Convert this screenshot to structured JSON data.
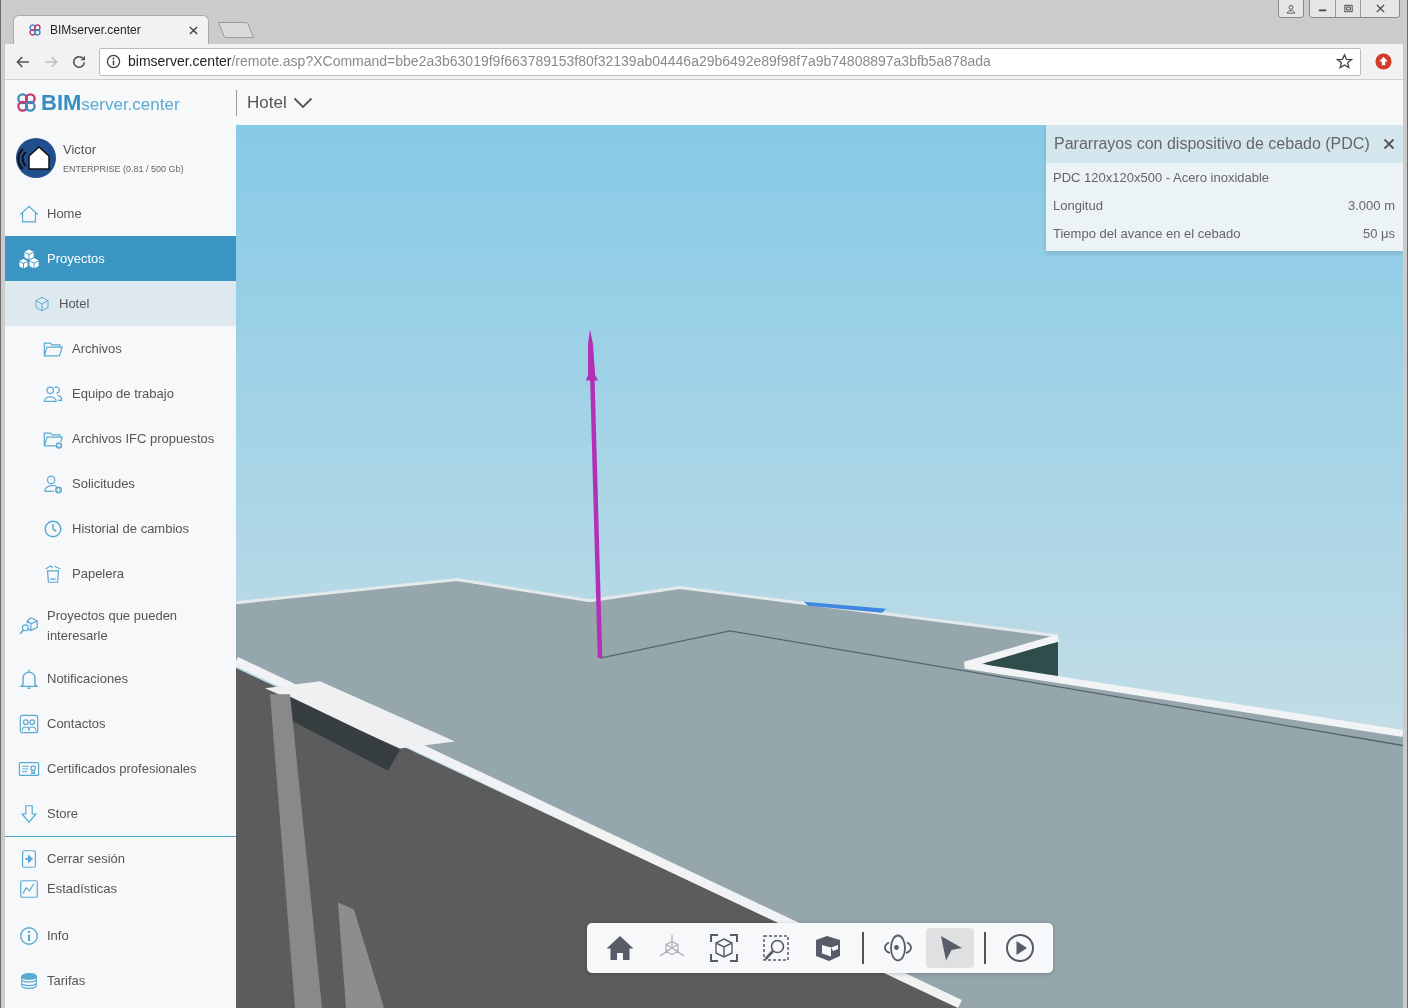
{
  "browser": {
    "tabs": [
      {
        "title": "BIMserver.center",
        "selected": true
      }
    ],
    "back": {
      "disabled": false
    },
    "forward": {
      "disabled": true
    },
    "address": {
      "host": "bimserver.center",
      "path": "/remote.asp?XCommand=bbe2a3b63019f9f663789153f80f32139ab04446a29b6492e89f98f7a9b74808897a3bfb5a878ada"
    }
  },
  "header": {
    "logo": "**BIM**server.center",
    "project": "Hotel"
  },
  "user": {
    "name": "Victor",
    "plan": "ENTERPRISE (0.81 / 500 Gb)"
  },
  "sidebar": {
    "items": [
      {
        "label": "Home",
        "selected": false
      },
      {
        "label": "Proyectos",
        "selected": true,
        "children": [
          {
            "label": "Hotel",
            "selected": true,
            "children": [
              {
                "label": "Archivos",
                "selected": false
              },
              {
                "label": "Equipo de trabajo",
                "selected": false
              },
              {
                "label": "Archivos IFC propuestos",
                "selected": false
              },
              {
                "label": "Solicitudes",
                "selected": false
              },
              {
                "label": "Historial de cambios",
                "selected": false
              },
              {
                "label": "Papelera",
                "selected": false
              }
            ]
          }
        ]
      },
      {
        "label": "Proyectos que pueden interesarle",
        "selected": false
      },
      {
        "label": "Notificaciones",
        "selected": false
      },
      {
        "label": "Contactos",
        "selected": false
      },
      {
        "label": "Certificados profesionales",
        "selected": false
      },
      {
        "label": "Store",
        "selected": false
      }
    ],
    "footer_items": [
      {
        "label": "Cerrar sesión",
        "selected": false
      },
      {
        "label": "Estadísticas",
        "selected": false
      },
      {
        "label": "Info",
        "selected": false
      },
      {
        "label": "Tarifas",
        "selected": false
      }
    ]
  },
  "info_panel": {
    "title": "Pararrayos con dispositivo de cebado (PDC)",
    "rows": [
      {
        "label": "PDC 120x120x500 - Acero inoxidable"
      },
      {
        "label": "Longitud",
        "value": "3.000 m"
      },
      {
        "label": "Tiempo del avance en el cebado",
        "value": "50 μs"
      }
    ]
  },
  "viewer_toolbar": {
    "groups": [
      {
        "tools": [
          {
            "selected": false,
            "disabled": false
          },
          {
            "selected": false,
            "disabled": true
          },
          {
            "selected": false,
            "disabled": false
          },
          {
            "selected": false,
            "disabled": false
          },
          {
            "selected": false,
            "disabled": false
          }
        ]
      },
      {
        "tools": [
          {
            "selected": false,
            "disabled": false
          },
          {
            "selected": true,
            "disabled": false
          }
        ]
      },
      {
        "tools": [
          {
            "selected": false,
            "disabled": false
          }
        ]
      }
    ]
  }
}
